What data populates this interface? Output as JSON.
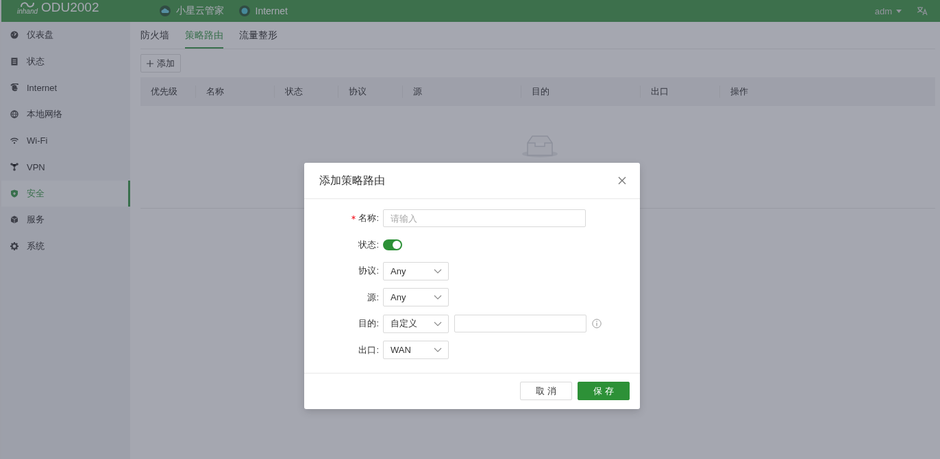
{
  "header": {
    "logo_text": "inhand",
    "product": "ODU2002",
    "links": [
      {
        "label": "小星云管家"
      },
      {
        "label": "Internet"
      }
    ],
    "user": "adm"
  },
  "sidebar": {
    "items": [
      {
        "label": "仪表盘",
        "selected": false
      },
      {
        "label": "状态",
        "selected": false
      },
      {
        "label": "Internet",
        "selected": false
      },
      {
        "label": "本地网络",
        "selected": false
      },
      {
        "label": "Wi-Fi",
        "selected": false
      },
      {
        "label": "VPN",
        "selected": false
      },
      {
        "label": "安全",
        "selected": true
      },
      {
        "label": "服务",
        "selected": false
      },
      {
        "label": "系统",
        "selected": false
      }
    ]
  },
  "tabs": [
    {
      "label": "防火墙",
      "selected": false
    },
    {
      "label": "策略路由",
      "selected": true
    },
    {
      "label": "流量整形",
      "selected": false
    }
  ],
  "add_button": "添加",
  "table": {
    "columns": [
      "优先级",
      "名称",
      "状态",
      "协议",
      "源",
      "目的",
      "出口",
      "操作"
    ]
  },
  "dialog": {
    "title": "添加策略路由",
    "fields": [
      {
        "kind": "text",
        "label": "名称:",
        "required": true,
        "placeholder": "请输入"
      },
      {
        "kind": "switch",
        "label": "状态:",
        "required": false,
        "on": true
      },
      {
        "kind": "select",
        "label": "协议:",
        "required": false,
        "value": "Any"
      },
      {
        "kind": "select",
        "label": "源:",
        "required": false,
        "value": "Any"
      },
      {
        "kind": "select_input",
        "label": "目的:",
        "required": false,
        "value": "自定义"
      },
      {
        "kind": "select",
        "label": "出口:",
        "required": false,
        "value": "WAN"
      }
    ],
    "buttons": [
      {
        "label": "取 消",
        "kind": "default"
      },
      {
        "label": "保 存",
        "kind": "primary"
      }
    ]
  }
}
